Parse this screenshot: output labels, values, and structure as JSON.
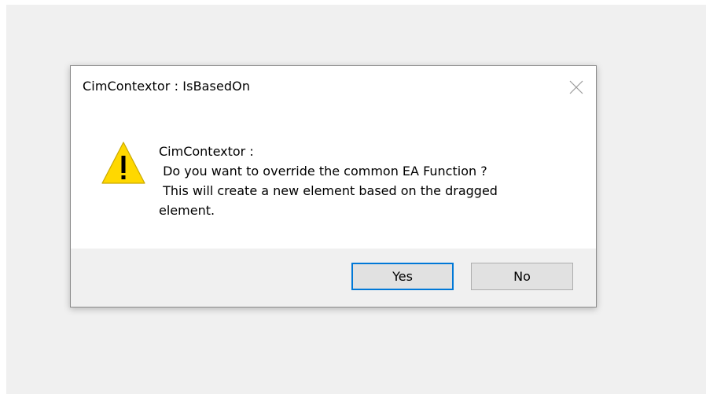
{
  "dialog": {
    "title": "CimContextor : IsBasedOn",
    "close_icon": "close-icon",
    "icon": "warning-icon",
    "message": "CimContextor :\n Do you want to override the common EA Function ?\n This will create a new element based on the dragged\nelement.",
    "buttons": {
      "yes_label": "Yes",
      "no_label": "No"
    }
  },
  "colors": {
    "backdrop": "#f0f0f0",
    "dialog_bg": "#ffffff",
    "footer_bg": "#f0f0f0",
    "button_bg": "#e1e1e1",
    "focus_border": "#0078d7",
    "warning_fill": "#ffd800"
  }
}
